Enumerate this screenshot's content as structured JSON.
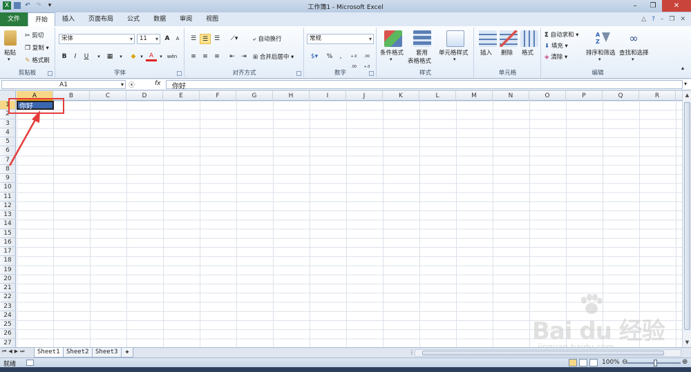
{
  "window": {
    "title": "工作簿1 - Microsoft Excel",
    "qat_icons": [
      "excel-icon",
      "save-icon",
      "undo-icon",
      "redo-icon",
      "customize-icon"
    ],
    "controls": [
      "minimize",
      "restore",
      "close"
    ]
  },
  "tabs": {
    "file": "文件",
    "items": [
      "开始",
      "插入",
      "页面布局",
      "公式",
      "数据",
      "审阅",
      "视图"
    ],
    "active": "开始"
  },
  "ribbon": {
    "clipboard": {
      "label": "剪贴板",
      "paste": "粘贴",
      "cut": "剪切",
      "copy": "复制",
      "format_painter": "格式刷"
    },
    "font": {
      "label": "字体",
      "font_name": "宋体",
      "font_size": "11",
      "bold": "B",
      "italic": "I",
      "underline": "U",
      "grow": "A",
      "shrink": "A",
      "font_color_glyph": "A",
      "phonetic_glyph": "wén"
    },
    "alignment": {
      "label": "对齐方式",
      "wrap_text": "自动换行",
      "merge_center": "合并后居中"
    },
    "number": {
      "label": "数字",
      "format": "常规",
      "percent": "%",
      "comma": ",",
      "inc_decimal": "+.0 .00",
      "dec_decimal": ".00 +.0"
    },
    "styles": {
      "label": "样式",
      "conditional": "条件格式",
      "table_line1": "套用",
      "table_line2": "表格格式",
      "cell_styles": "单元格样式"
    },
    "cells": {
      "label": "单元格",
      "insert": "插入",
      "delete": "删除",
      "format": "格式"
    },
    "editing": {
      "label": "编辑",
      "autosum": "自动求和",
      "fill": "填充",
      "clear": "清除",
      "sort": "排序和筛选",
      "find": "查找和选择"
    }
  },
  "formula_bar": {
    "name_box": "A1",
    "fx": "fx",
    "value": "你好"
  },
  "sheet": {
    "columns": [
      "A",
      "B",
      "C",
      "D",
      "E",
      "F",
      "G",
      "H",
      "I",
      "J",
      "K",
      "L",
      "M",
      "N",
      "O",
      "P",
      "Q",
      "R"
    ],
    "rows": [
      "1",
      "2",
      "3",
      "4",
      "5",
      "6",
      "7",
      "8",
      "9",
      "10",
      "11",
      "12",
      "13",
      "14",
      "15",
      "16",
      "17",
      "18",
      "19",
      "20",
      "21",
      "22",
      "23",
      "24",
      "25",
      "26",
      "27"
    ],
    "selected_cell": "A1",
    "cells": {
      "A1": "你好"
    }
  },
  "sheet_tabs": [
    "Sheet1",
    "Sheet2",
    "Sheet3"
  ],
  "active_sheet": "Sheet1",
  "status": {
    "ready": "就绪",
    "zoom": "100%"
  },
  "watermark": {
    "logo": "Bai du 经验",
    "url": "jingyan.baidu.com"
  },
  "colors": {
    "selection": "#3a66b0",
    "annotation": "#e53a3a",
    "file_tab": "#2a7b3e"
  }
}
